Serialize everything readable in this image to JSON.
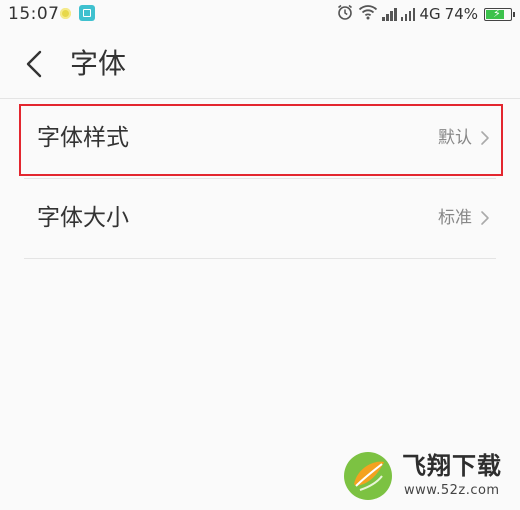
{
  "status_bar": {
    "time": "15:07",
    "network": "4G",
    "battery_percent_text": "74%",
    "battery_level": 0.74,
    "icons": [
      "notification-dot-icon",
      "app-notification-icon",
      "alarm-icon",
      "wifi-icon",
      "signal-icon",
      "signal-icon",
      "battery-icon"
    ]
  },
  "header": {
    "back_icon": "chevron-left-icon",
    "title": "字体"
  },
  "settings": {
    "items": [
      {
        "label": "字体样式",
        "value": "默认",
        "highlighted": true
      },
      {
        "label": "字体大小",
        "value": "标准",
        "highlighted": false
      }
    ]
  },
  "watermark": {
    "title": "飞翔下载",
    "url": "www.52z.com"
  },
  "colors": {
    "background": "#fafafa",
    "highlight_border": "#e3262f",
    "battery_fill": "#3cc24c",
    "text_primary": "#333333",
    "text_secondary": "#888888"
  }
}
